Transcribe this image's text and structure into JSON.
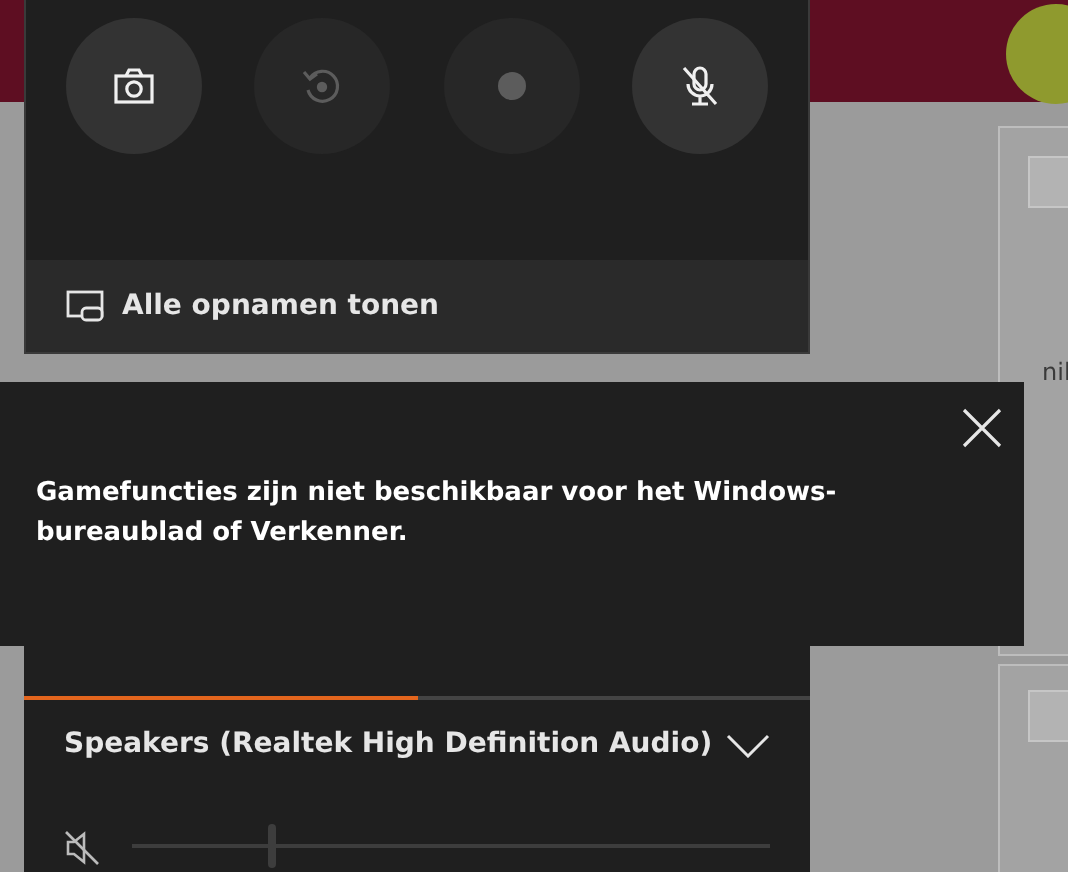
{
  "capture": {
    "buttons": [
      {
        "kind": "screenshot",
        "disabled": false
      },
      {
        "kind": "record_last",
        "disabled": true
      },
      {
        "kind": "record",
        "disabled": true
      },
      {
        "kind": "mic",
        "disabled": false
      }
    ],
    "gallery_link": "Alle opnamen tonen"
  },
  "notification": {
    "message": "Gamefuncties zijn niet beschikbaar voor het Windows-bureaublad of Verkenner."
  },
  "audio": {
    "tabs": [
      {
        "selected": true
      },
      {
        "selected": false
      }
    ],
    "device": "Speakers (Realtek High Definition Audio)",
    "muted": true,
    "level": 0.22
  },
  "background": {
    "side_text": "nil"
  }
}
